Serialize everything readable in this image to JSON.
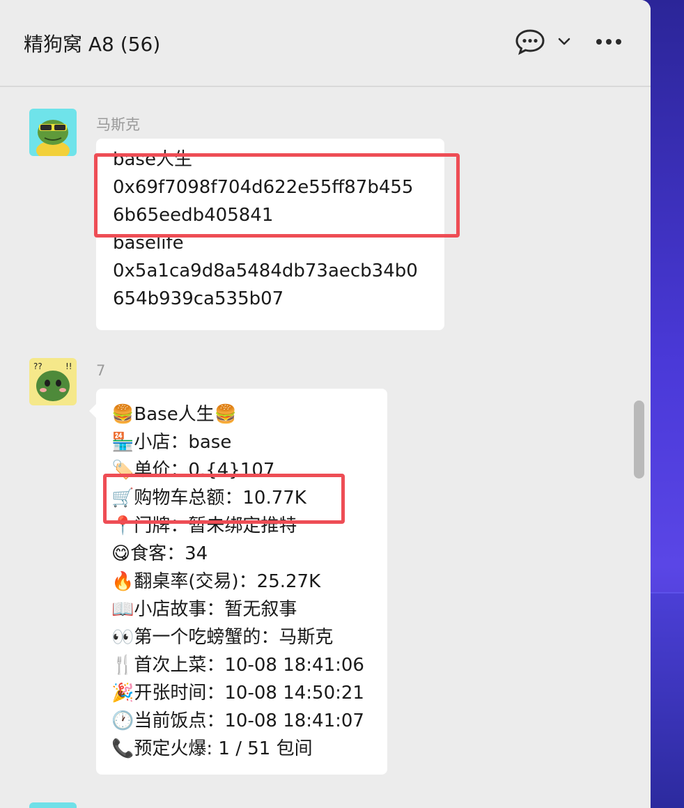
{
  "header": {
    "title": "精狗窝 A8 (56)"
  },
  "messages": [
    {
      "sender": "马斯克",
      "avatar_icon": "frog-with-sunglasses-avatar",
      "lines": [
        "base人生",
        "0x69f7098f704d622e55ff87b455",
        "6b65eedb405841",
        "baselife",
        "0x5a1ca9d8a5484db73aecb34b0",
        "654b939ca535b07"
      ]
    },
    {
      "sender": "7",
      "avatar_icon": "green-creature-avatar",
      "lines": [
        "🍔Base人生🍔",
        "🏪小店：base",
        "🏷️单价：0.{4}107",
        "🛒购物车总额：10.77K",
        "📍门牌：暂未绑定推特",
        "😋食客：34",
        "🔥翻桌率(交易)：25.27K",
        "📖小店故事：暂无叙事",
        "👀第一个吃螃蟹的：马斯克",
        "🍴首次上菜：10-08 18:41:06",
        "🎉开张时间：10-08 14:50:21",
        "🕐当前饭点：10-08 18:41:07",
        "📞预定火爆: 1 / 51 包间"
      ]
    }
  ],
  "colors": {
    "highlight": "#ee4d55",
    "window_bg": "#ececec",
    "bubble_bg": "#ffffff"
  }
}
